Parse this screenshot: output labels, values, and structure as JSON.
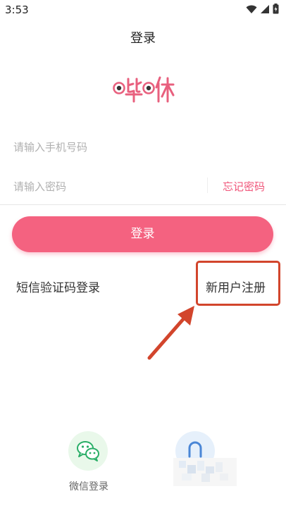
{
  "status_bar": {
    "time": "3:53"
  },
  "nav": {
    "title": "登录"
  },
  "logo": {
    "text": "哔咻"
  },
  "form": {
    "phone_placeholder": "请输入手机号码",
    "password_placeholder": "请输入密码",
    "forgot_password": "忘记密码"
  },
  "login_button": "登录",
  "links": {
    "sms_login": "短信验证码登录",
    "register": "新用户注册"
  },
  "social": {
    "wechat_label": "微信登录"
  },
  "colors": {
    "brand_pink": "#f46280",
    "annotation_red": "#d2452c",
    "wechat_green": "#2aae67"
  }
}
